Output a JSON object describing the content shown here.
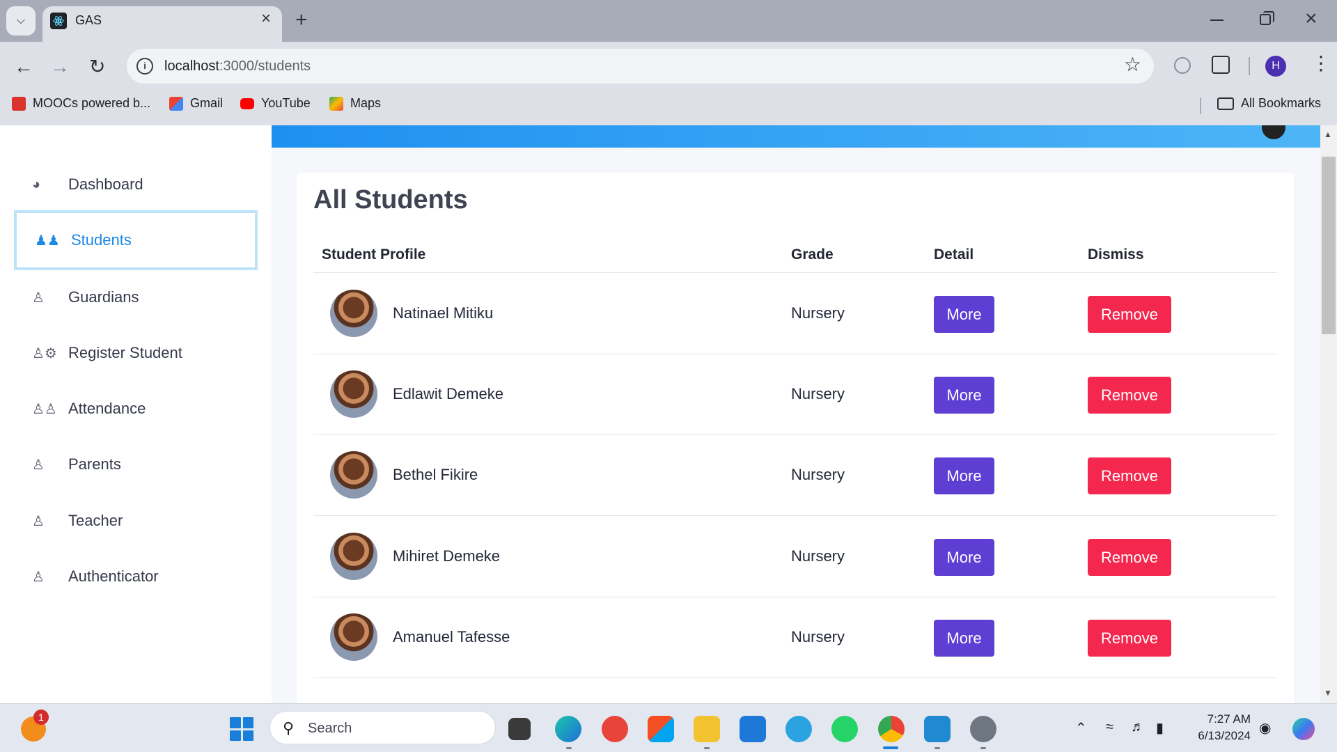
{
  "browser": {
    "tab_title": "GAS",
    "url_host": "localhost",
    "url_path": ":3000/students",
    "bookmarks": [
      "MOOCs powered b...",
      "Gmail",
      "YouTube",
      "Maps"
    ],
    "all_bookmarks": "All Bookmarks",
    "profile_initial": "H"
  },
  "sidebar": {
    "items": [
      {
        "label": "Dashboard",
        "icon": "dashboard-icon"
      },
      {
        "label": "Students",
        "icon": "users-icon",
        "active": true
      },
      {
        "label": "Guardians",
        "icon": "person-icon"
      },
      {
        "label": "Register Student",
        "icon": "person-gear-icon"
      },
      {
        "label": "Attendance",
        "icon": "people-icon"
      },
      {
        "label": "Parents",
        "icon": "person-icon"
      },
      {
        "label": "Teacher",
        "icon": "person-icon"
      },
      {
        "label": "Authenticator",
        "icon": "person-icon"
      }
    ]
  },
  "main": {
    "title": "All Students",
    "columns": [
      "Student Profile",
      "Grade",
      "Detail",
      "Dismiss"
    ],
    "rows": [
      {
        "name": "Natinael Mitiku",
        "grade": "Nursery",
        "detail": "More",
        "dismiss": "Remove"
      },
      {
        "name": "Edlawit Demeke",
        "grade": "Nursery",
        "detail": "More",
        "dismiss": "Remove"
      },
      {
        "name": "Bethel Fikire",
        "grade": "Nursery",
        "detail": "More",
        "dismiss": "Remove"
      },
      {
        "name": "Mihiret Demeke",
        "grade": "Nursery",
        "detail": "More",
        "dismiss": "Remove"
      },
      {
        "name": "Amanuel Tafesse",
        "grade": "Nursery",
        "detail": "More",
        "dismiss": "Remove"
      }
    ]
  },
  "taskbar": {
    "search_placeholder": "Search",
    "notification_count": "1",
    "time": "7:27 AM",
    "date": "6/13/2024"
  },
  "colors": {
    "primary": "#1e88e5",
    "more_button": "#5f3fd3",
    "remove_button": "#f4284e"
  }
}
